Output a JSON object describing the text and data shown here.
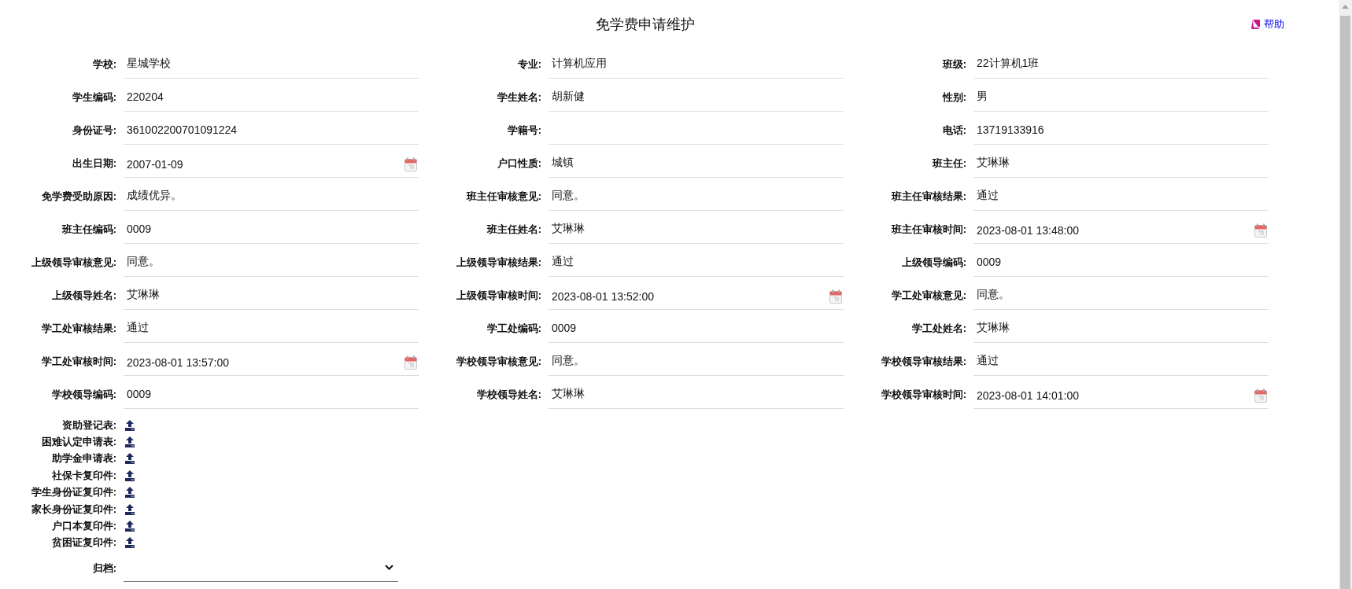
{
  "title": "免学费申请维护",
  "help": {
    "label": "帮助"
  },
  "fields": [
    {
      "label": "学校:",
      "value": "星城学校",
      "kind": "text"
    },
    {
      "label": "专业:",
      "value": "计算机应用",
      "kind": "text"
    },
    {
      "label": "班级:",
      "value": "22计算机1班",
      "kind": "text"
    },
    {
      "label": "学生编码:",
      "value": "220204",
      "kind": "text"
    },
    {
      "label": "学生姓名:",
      "value": "胡新健",
      "kind": "text"
    },
    {
      "label": "性别:",
      "value": "男",
      "kind": "text"
    },
    {
      "label": "身份证号:",
      "value": "361002200701091224",
      "kind": "text"
    },
    {
      "label": "学籍号:",
      "kind": "text"
    },
    {
      "label": "电话:",
      "value": "13719133916",
      "kind": "text"
    },
    {
      "label": "出生日期:",
      "value": "2007-01-09",
      "kind": "date"
    },
    {
      "label": "户口性质:",
      "value": "城镇",
      "kind": "text"
    },
    {
      "label": "班主任:",
      "value": "艾琳琳",
      "kind": "text"
    },
    {
      "label": "免学费受助原因:",
      "value": "成绩优异。",
      "kind": "text"
    },
    {
      "label": "班主任审核意见:",
      "value": "同意。",
      "kind": "text"
    },
    {
      "label": "班主任审核结果:",
      "value": "通过",
      "kind": "text"
    },
    {
      "label": "班主任编码:",
      "value": "0009",
      "kind": "text"
    },
    {
      "label": "班主任姓名:",
      "value": "艾琳琳",
      "kind": "text"
    },
    {
      "label": "班主任审核时间:",
      "value": "2023-08-01 13:48:00",
      "kind": "date"
    },
    {
      "label": "上级领导审核意见:",
      "value": "同意。",
      "kind": "text"
    },
    {
      "label": "上级领导审核结果:",
      "value": "通过",
      "kind": "text"
    },
    {
      "label": "上级领导编码:",
      "value": "0009",
      "kind": "text"
    },
    {
      "label": "上级领导姓名:",
      "value": "艾琳琳",
      "kind": "text"
    },
    {
      "label": "上级领导审核时间:",
      "value": "2023-08-01 13:52:00",
      "kind": "date"
    },
    {
      "label": "学工处审核意见:",
      "value": "同意。",
      "kind": "text"
    },
    {
      "label": "学工处审核结果:",
      "value": "通过",
      "kind": "text"
    },
    {
      "label": "学工处编码:",
      "value": "0009",
      "kind": "text"
    },
    {
      "label": "学工处姓名:",
      "value": "艾琳琳",
      "kind": "text"
    },
    {
      "label": "学工处审核时间:",
      "value": "2023-08-01 13:57:00",
      "kind": "date"
    },
    {
      "label": "学校领导审核意见:",
      "value": "同意。",
      "kind": "text"
    },
    {
      "label": "学校领导审核结果:",
      "value": "通过",
      "kind": "text"
    },
    {
      "label": "学校领导编码:",
      "value": "0009",
      "kind": "text"
    },
    {
      "label": "学校领导姓名:",
      "value": "艾琳琳",
      "kind": "text"
    },
    {
      "label": "学校领导审核时间:",
      "value": "2023-08-01 14:01:00",
      "kind": "date"
    }
  ],
  "uploads": [
    "资助登记表:",
    "困难认定申请表:",
    "助学金申请表:",
    "社保卡复印件:",
    "学生身份证复印件:",
    "家长身份证复印件:",
    "户口本复印件:",
    "贫困证复印件:"
  ],
  "archive": {
    "label": "归档:"
  }
}
